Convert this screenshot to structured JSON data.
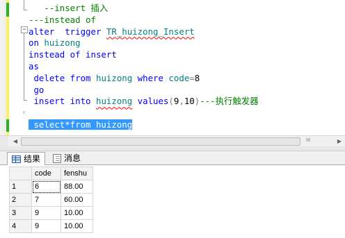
{
  "editor": {
    "lines": [
      [
        {
          "t": "   --insert ",
          "c": "cm"
        },
        {
          "t": "插入",
          "c": "cm zh"
        }
      ],
      [
        {
          "t": "---instead of",
          "c": "cm"
        }
      ],
      [
        {
          "t": "alter  trigger ",
          "c": "kw sqx"
        },
        {
          "t": "TR_huizong_Insert",
          "c": "id sq"
        }
      ],
      [
        {
          "t": "on ",
          "c": "kw"
        },
        {
          "t": "huizong",
          "c": "id"
        }
      ],
      [
        {
          "t": "instead of insert",
          "c": "kw"
        }
      ],
      [
        {
          "t": "as",
          "c": "kw"
        }
      ],
      [
        {
          "t": " delete from ",
          "c": "kw"
        },
        {
          "t": "huizong ",
          "c": "id"
        },
        {
          "t": "where ",
          "c": "kw"
        },
        {
          "t": "code",
          "c": "id"
        },
        {
          "t": "=",
          "c": "gy"
        },
        {
          "t": "8",
          "c": "num"
        }
      ],
      [
        {
          "t": " go",
          "c": "kw"
        }
      ],
      [
        {
          "t": " insert into ",
          "c": "kw"
        },
        {
          "t": "huizong",
          "c": "id sq"
        },
        {
          "t": " values",
          "c": "kw"
        },
        {
          "t": "(",
          "c": "gy"
        },
        {
          "t": "9",
          "c": "num"
        },
        {
          "t": ",",
          "c": "gy"
        },
        {
          "t": "10",
          "c": "num"
        },
        {
          "t": ")",
          "c": "gy"
        },
        {
          "t": "---",
          "c": "cm"
        },
        {
          "t": "执行触发器",
          "c": "cm zh"
        }
      ],
      [
        {
          "t": "",
          "c": ""
        }
      ],
      [
        {
          "t": " select*from huizong",
          "c": "sel"
        }
      ]
    ]
  },
  "tabs": {
    "results_label": "结果",
    "messages_label": "消息"
  },
  "grid": {
    "columns": [
      "code",
      "fenshu"
    ],
    "rows": [
      {
        "num": "1",
        "code": "6",
        "fenshu": "88.00"
      },
      {
        "num": "2",
        "code": "7",
        "fenshu": "60.00"
      },
      {
        "num": "3",
        "code": "9",
        "fenshu": "10.00"
      },
      {
        "num": "4",
        "code": "9",
        "fenshu": "10.00"
      }
    ]
  },
  "icons": {
    "results_tab_icon": "grid-icon",
    "messages_tab_icon": "message-icon",
    "scroll_left": "arrow-left-icon",
    "scroll_right": "arrow-right-icon",
    "scroll_grip": "grip-icon"
  },
  "colors": {
    "keyword": "#0000ff",
    "comment": "#008000",
    "identifier": "#008080",
    "selection": "#3399ff",
    "change_track": "#ffee62"
  }
}
